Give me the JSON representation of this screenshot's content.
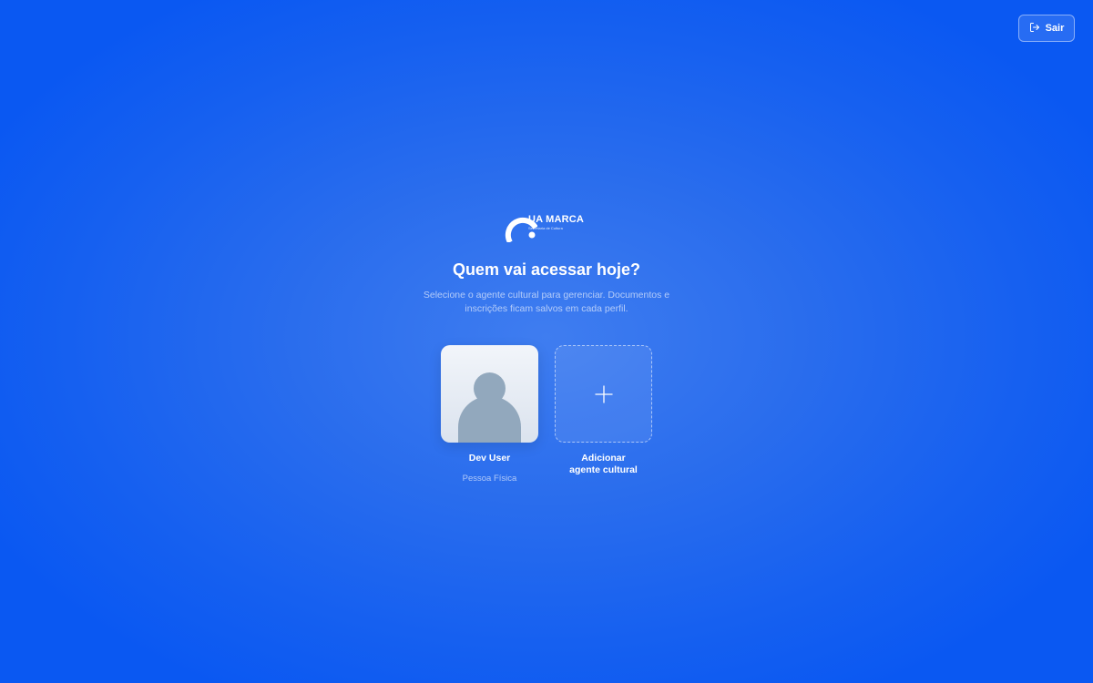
{
  "header": {
    "logout_label": "Sair",
    "logout_icon": "logout-icon"
  },
  "brand": {
    "name": "UA MARCA",
    "subtitle": "Secretaria de Cultura",
    "logo_icon": "brand-logo-icon"
  },
  "main": {
    "title": "Quem vai acessar hoje?",
    "subtitle": "Selecione o agente cultural para gerenciar. Documentos e inscrições ficam salvos em cada perfil."
  },
  "profiles": [
    {
      "name": "Dev User",
      "type": "Pessoa Física",
      "avatar_icon": "user-avatar-icon"
    }
  ],
  "add_profile": {
    "label_line1": "Adicionar",
    "label_line2": "agente cultural",
    "icon": "plus-icon"
  },
  "colors": {
    "background": "#1660f0",
    "background_center": "#3f7df0",
    "avatar_placeholder": "#92a8bd"
  }
}
